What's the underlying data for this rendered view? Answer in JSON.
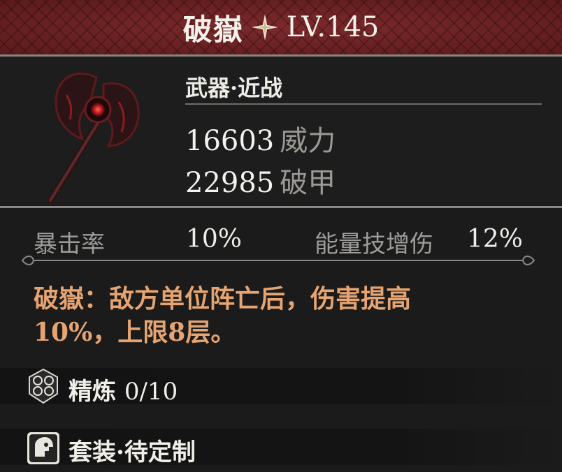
{
  "header": {
    "name": "破嶽",
    "level": "LV.145",
    "star_icon": "four-point-star-icon"
  },
  "weapon": {
    "category": "武器·近战",
    "image_icon": "battle-axe-icon"
  },
  "main_stats": [
    {
      "value": "16603",
      "label": "威力"
    },
    {
      "value": "22985",
      "label": "破甲"
    }
  ],
  "sub_stats": [
    {
      "label": "暴击率",
      "value": "10%"
    },
    {
      "label": "能量技增伤",
      "value": "12%"
    }
  ],
  "description": {
    "line1": "破嶽：敌方单位阵亡后，伤害提高",
    "line2": "10%，上限8层。"
  },
  "refine": {
    "label": "精炼",
    "value": "0/10",
    "icon": "honeycomb-icon"
  },
  "set": {
    "label": "套装·待定制",
    "icon": "set-helmet-icon"
  },
  "colors": {
    "header": "#6a1f22",
    "description": "#e5a471",
    "label": "#9b9994"
  }
}
